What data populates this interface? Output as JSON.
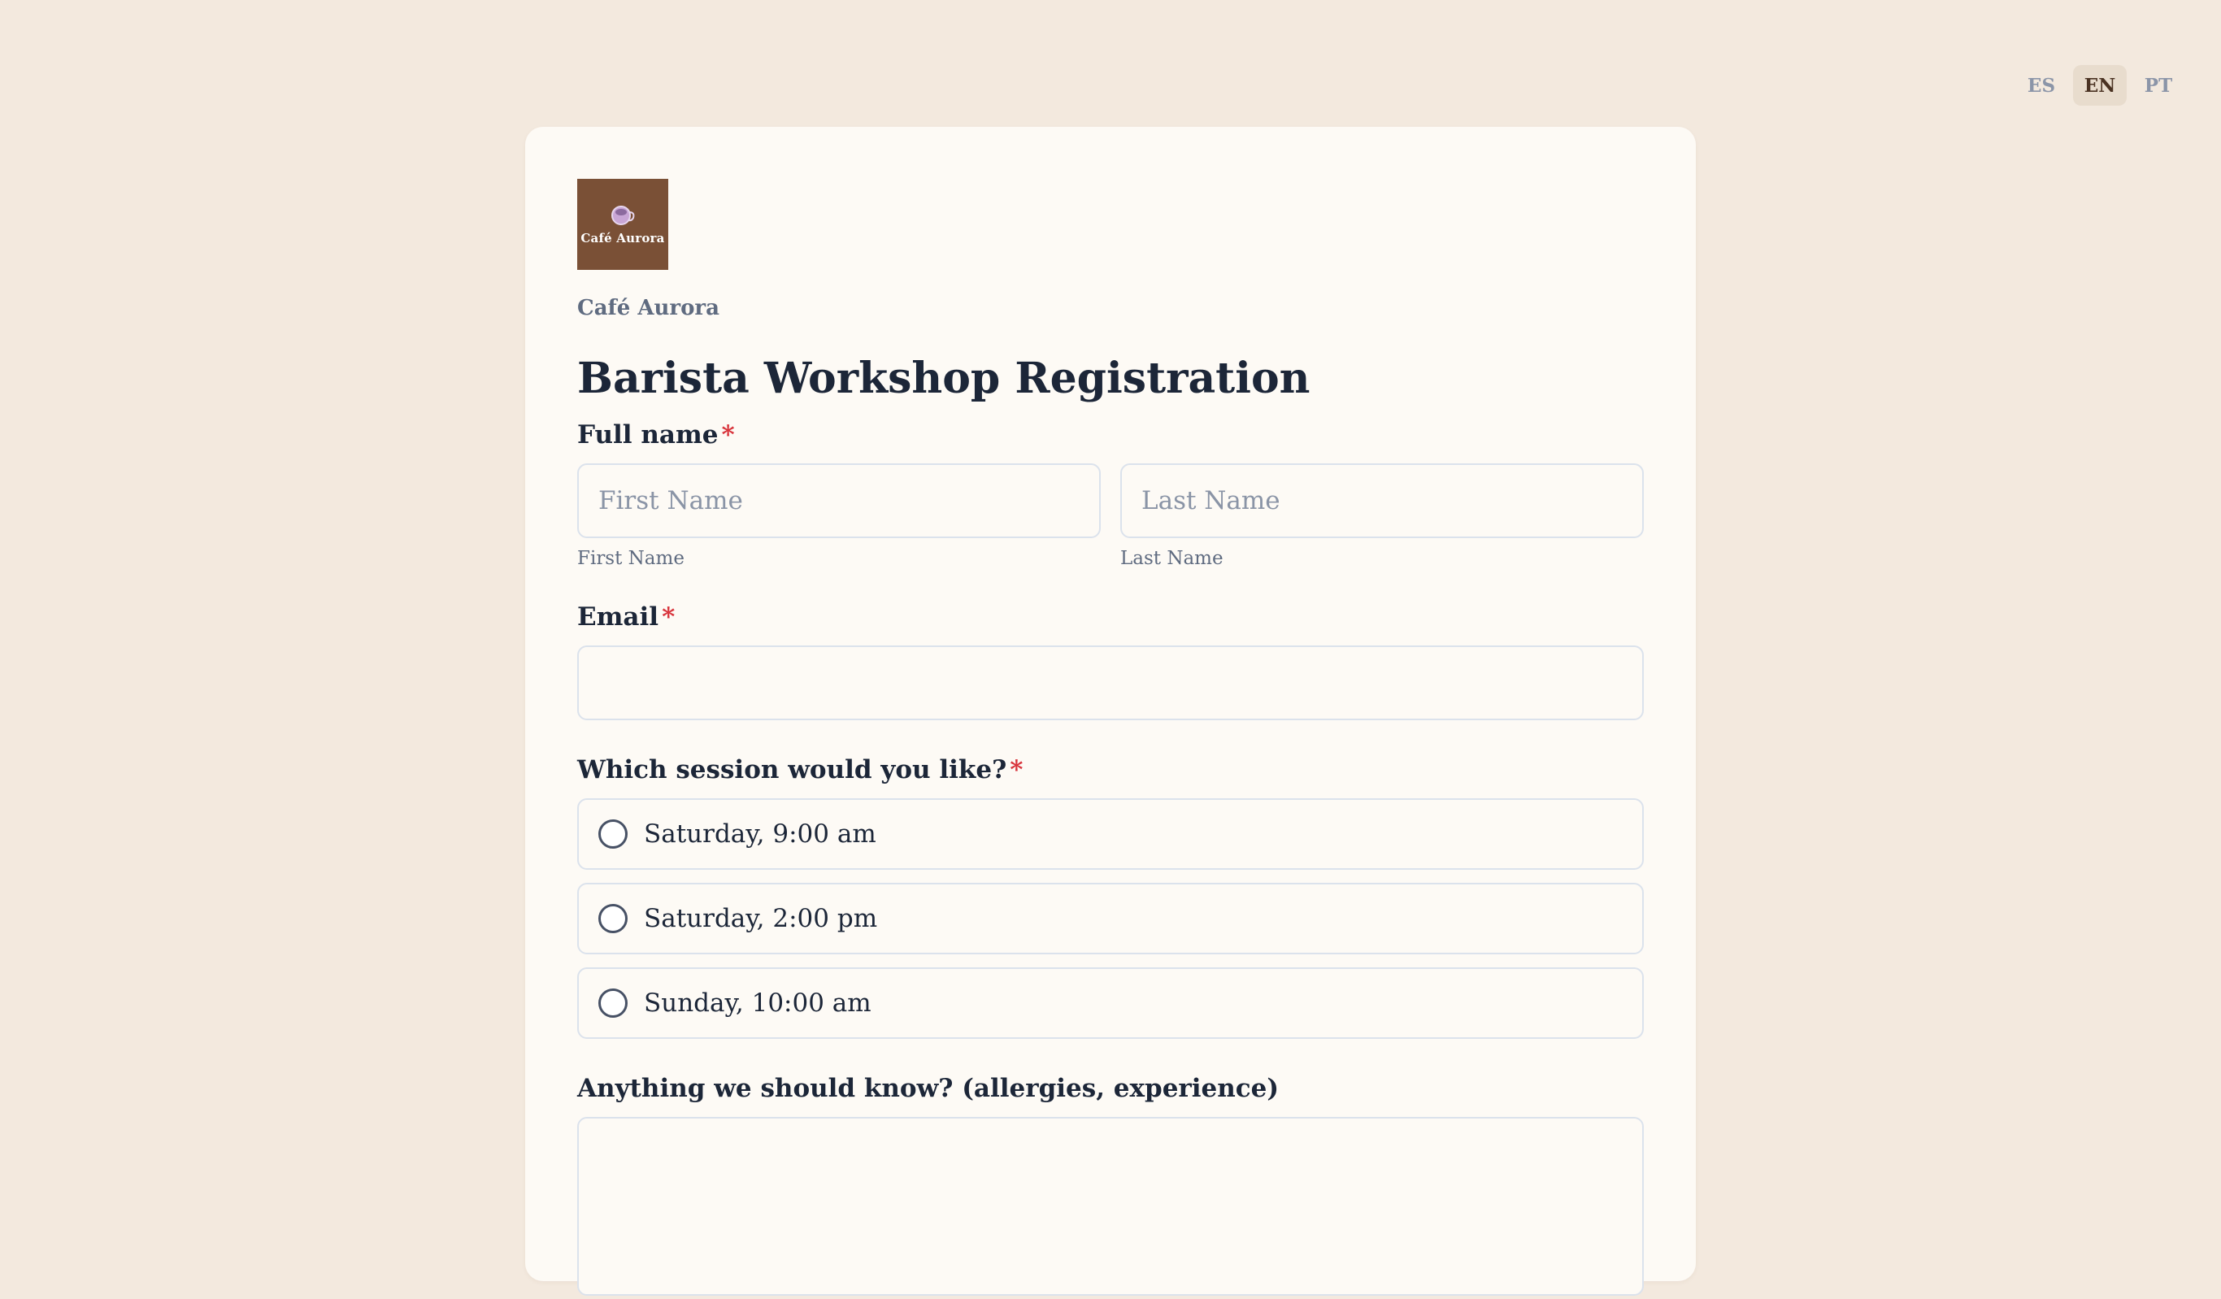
{
  "languages": {
    "es": "ES",
    "en": "EN",
    "pt": "PT",
    "active": "EN"
  },
  "brand": {
    "logo_text": "Café Aurora",
    "name": "Café Aurora",
    "logo_bg": "#7a5036",
    "logo_icon": "coffee-cup-icon"
  },
  "form": {
    "title": "Barista Workshop Registration",
    "full_name": {
      "label": "Full name",
      "required_mark": "*",
      "first_placeholder": "First Name",
      "first_sublabel": "First Name",
      "last_placeholder": "Last Name",
      "last_sublabel": "Last Name",
      "first_value": "",
      "last_value": ""
    },
    "email": {
      "label": "Email",
      "required_mark": "*",
      "value": ""
    },
    "session": {
      "label": "Which session would you like?",
      "required_mark": "*",
      "options": [
        "Saturday, 9:00 am",
        "Saturday, 2:00 pm",
        "Sunday, 10:00 am"
      ],
      "selected": null
    },
    "notes": {
      "label": "Anything we should know? (allergies, experience)",
      "value": ""
    }
  },
  "colors": {
    "page_bg": "#f3e9de",
    "card_bg": "#fdfaf5",
    "required": "#d8343c",
    "text": "#1c2638"
  }
}
